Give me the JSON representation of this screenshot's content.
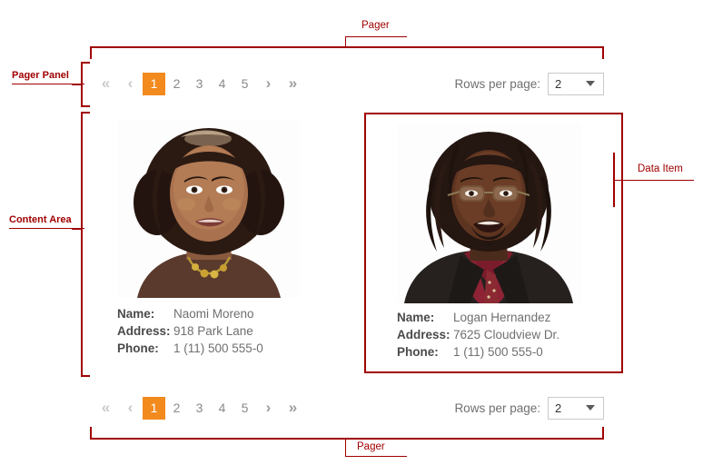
{
  "annotations": {
    "pager_top": "Pager",
    "pager_panel": "Pager Panel",
    "content_area": "Content Area",
    "data_item": "Data Item",
    "pager_bottom": "Pager",
    "color": "#A00000"
  },
  "theme": {
    "accent": "#F28A1E",
    "accent_text": "#FFFFFF",
    "page_text": "#8A8A8A",
    "arrow": "#9E9E9E",
    "arrow_disabled": "#C9C9C9",
    "label_text": "#6F6F6F",
    "value_text": "#6F6F6F",
    "key_text": "#4A4A4A",
    "select_border": "#C9C9C9"
  },
  "pager_top": {
    "first_icon": "double-chevron-left-icon",
    "prev_icon": "chevron-left-icon",
    "next_icon": "chevron-right-icon",
    "last_icon": "double-chevron-right-icon",
    "first_label": "«",
    "prev_label": "‹",
    "next_label": "›",
    "last_label": "»",
    "pages": [
      "1",
      "2",
      "3",
      "4",
      "5"
    ],
    "selected_page": "1",
    "rows_per_page_label": "Rows per page:",
    "rows_per_page_value": "2",
    "rows_per_page_options": [
      "2"
    ]
  },
  "pager_bottom": {
    "first_label": "«",
    "prev_label": "‹",
    "next_label": "›",
    "last_label": "»",
    "pages": [
      "1",
      "2",
      "3",
      "4",
      "5"
    ],
    "selected_page": "1",
    "rows_per_page_label": "Rows per page:",
    "rows_per_page_value": "2",
    "rows_per_page_options": [
      "2"
    ]
  },
  "content": {
    "field_labels": {
      "name": "Name:",
      "address": "Address:",
      "phone": "Phone:"
    },
    "items": [
      {
        "photo": "portrait-woman-photo",
        "name": "Naomi Moreno",
        "address": "918 Park Lane",
        "phone": "1 (11) 500 555-0",
        "highlighted": false
      },
      {
        "photo": "portrait-man-photo",
        "name": "Logan Hernandez",
        "address": "7625 Cloudview Dr.",
        "phone": "1 (11) 500 555-0",
        "highlighted": true
      }
    ]
  }
}
